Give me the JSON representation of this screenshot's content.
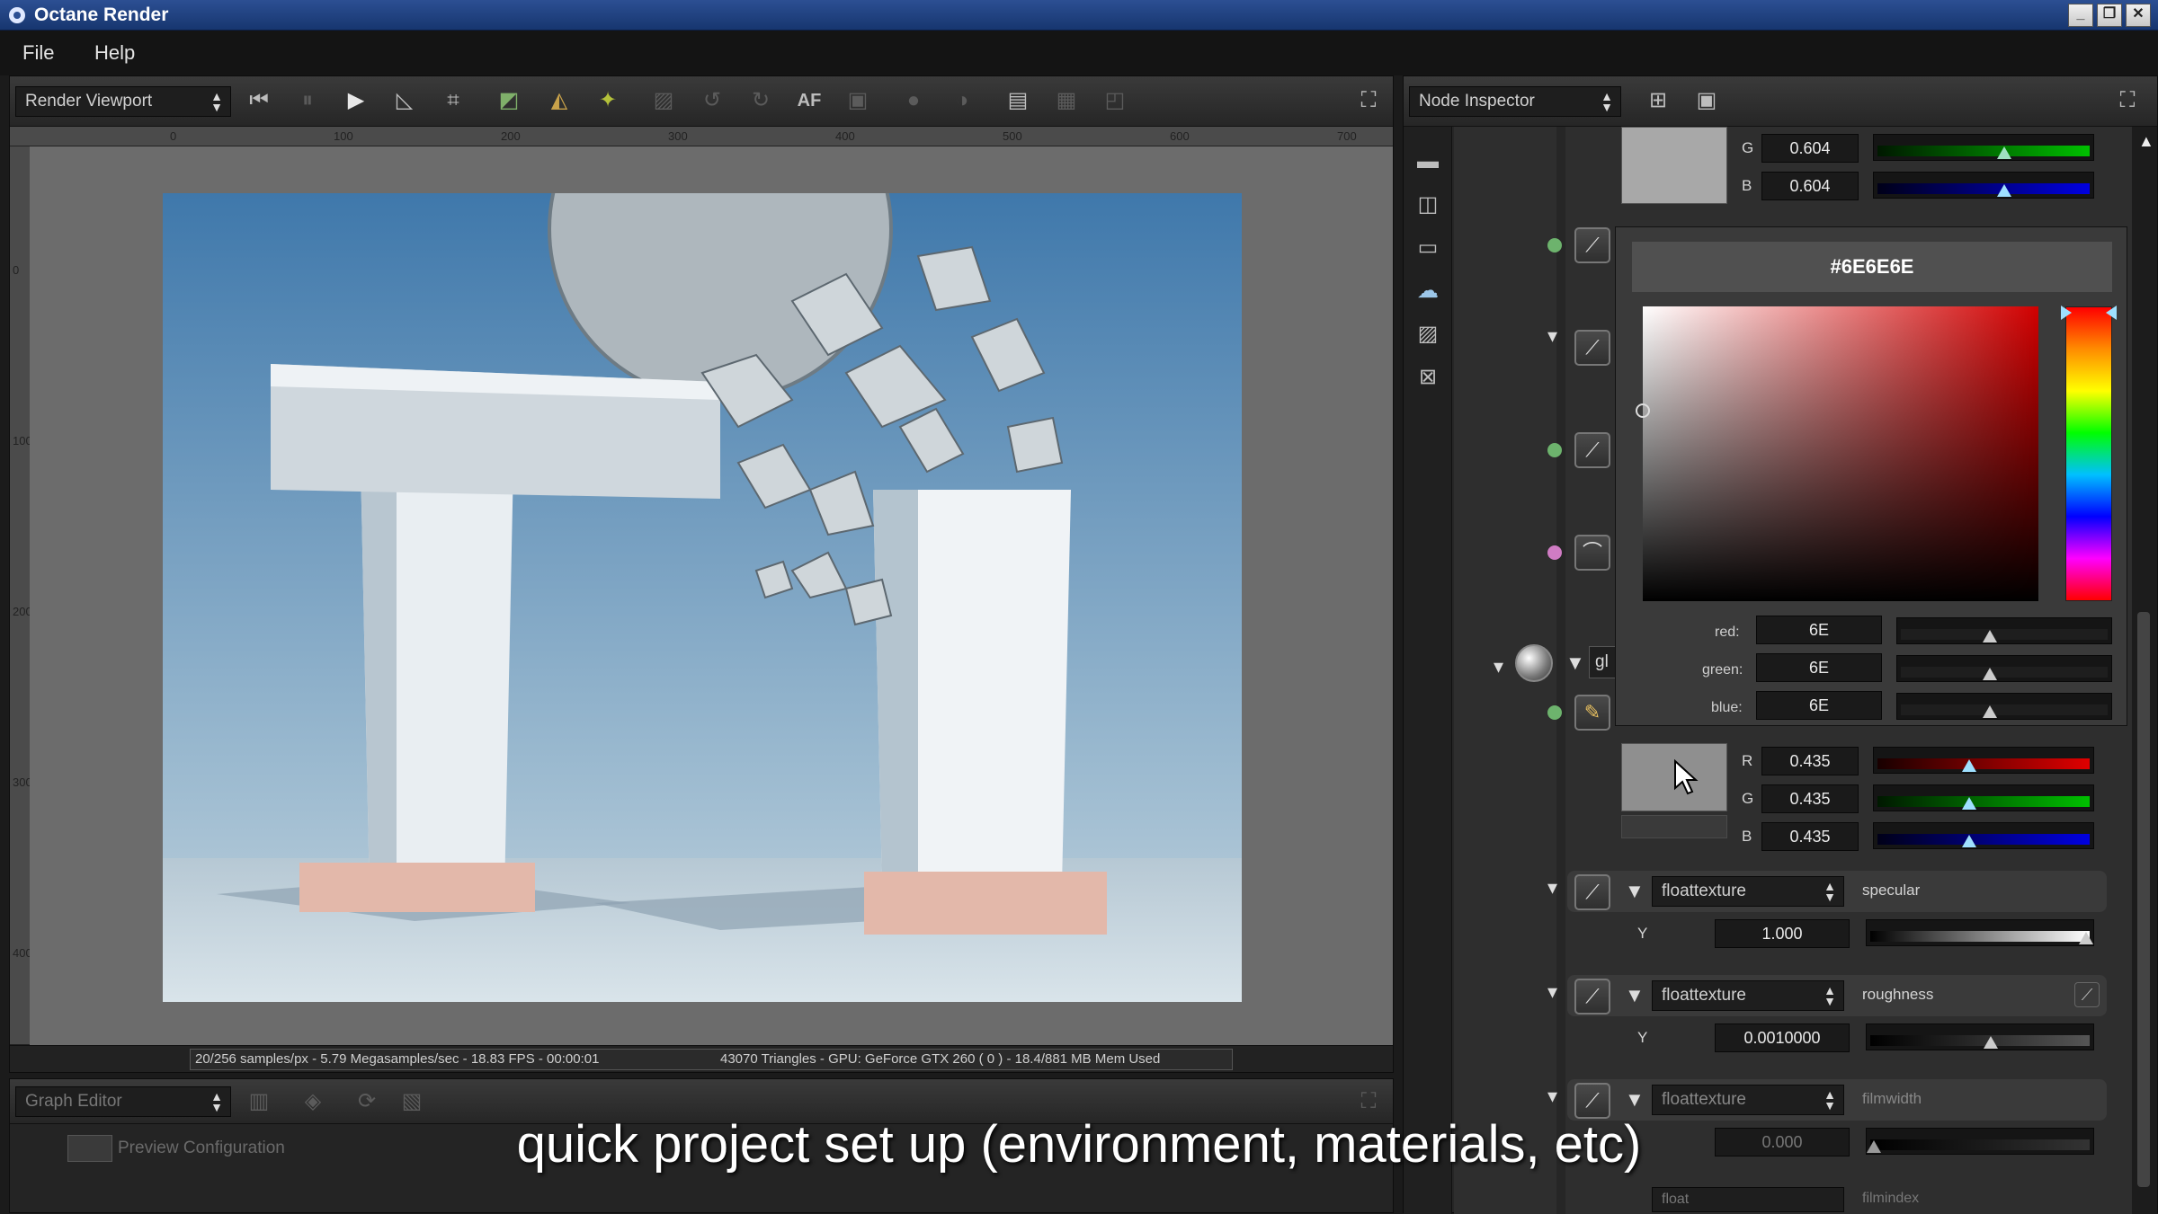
{
  "window": {
    "title": "Octane Render",
    "minimize": "_",
    "restore": "❐",
    "close": "✕"
  },
  "menu": {
    "items": [
      "File",
      "Help"
    ]
  },
  "render_viewport": {
    "selector": "Render Viewport",
    "autofocus_label": "AF",
    "ruler_ticks": [
      "0",
      "100",
      "200",
      "300",
      "400",
      "500",
      "600",
      "700"
    ],
    "v_ruler_ticks": [
      "0",
      "100",
      "200",
      "300",
      "400"
    ],
    "status_left": "20/256 samples/px - 5.79 Megasamples/sec - 18.83 FPS - 00:00:01",
    "status_right": "43070 Triangles - GPU: GeForce GTX 260 ( 0 ) - 18.4/881 MB Mem Used"
  },
  "graph_editor": {
    "selector": "Graph Editor",
    "preview_label": "Preview Configuration"
  },
  "node_inspector": {
    "selector": "Node Inspector",
    "top_color": {
      "g_label": "G",
      "g_value": "0.604",
      "b_label": "B",
      "b_value": "0.604"
    },
    "picker": {
      "hex": "#6E6E6E",
      "red_label": "red:",
      "red_value": "6E",
      "green_label": "green:",
      "green_value": "6E",
      "blue_label": "blue:",
      "blue_value": "6E"
    },
    "partial_node": "gl",
    "second_color": {
      "r_label": "R",
      "r_value": "0.435",
      "g_label": "G",
      "g_value": "0.435",
      "b_label": "B",
      "b_value": "0.435"
    },
    "specular": {
      "type": "floattexture",
      "name": "specular",
      "y_label": "Y",
      "value": "1.000",
      "level": 1.0
    },
    "roughness": {
      "type": "floattexture",
      "name": "roughness",
      "y_label": "Y",
      "value": "0.0010000",
      "level": 0.55
    },
    "filmwidth": {
      "type": "floattexture",
      "name": "filmwidth",
      "value": "0.000",
      "level": 0.0
    },
    "bottom_partial": {
      "type": "float",
      "name": "filmindex"
    },
    "color_slider_levels": {
      "top_g": 0.6,
      "top_b": 0.6,
      "second_r": 0.43,
      "second_g": 0.43,
      "second_b": 0.43,
      "picker_r": 0.43,
      "picker_g": 0.43,
      "picker_b": 0.43
    }
  },
  "caption": "quick project set up (environment, materials, etc)",
  "colors": {
    "titlebar": "#1f438a",
    "accent_green": "#6db36d",
    "accent_pink": "#d07cc4"
  }
}
